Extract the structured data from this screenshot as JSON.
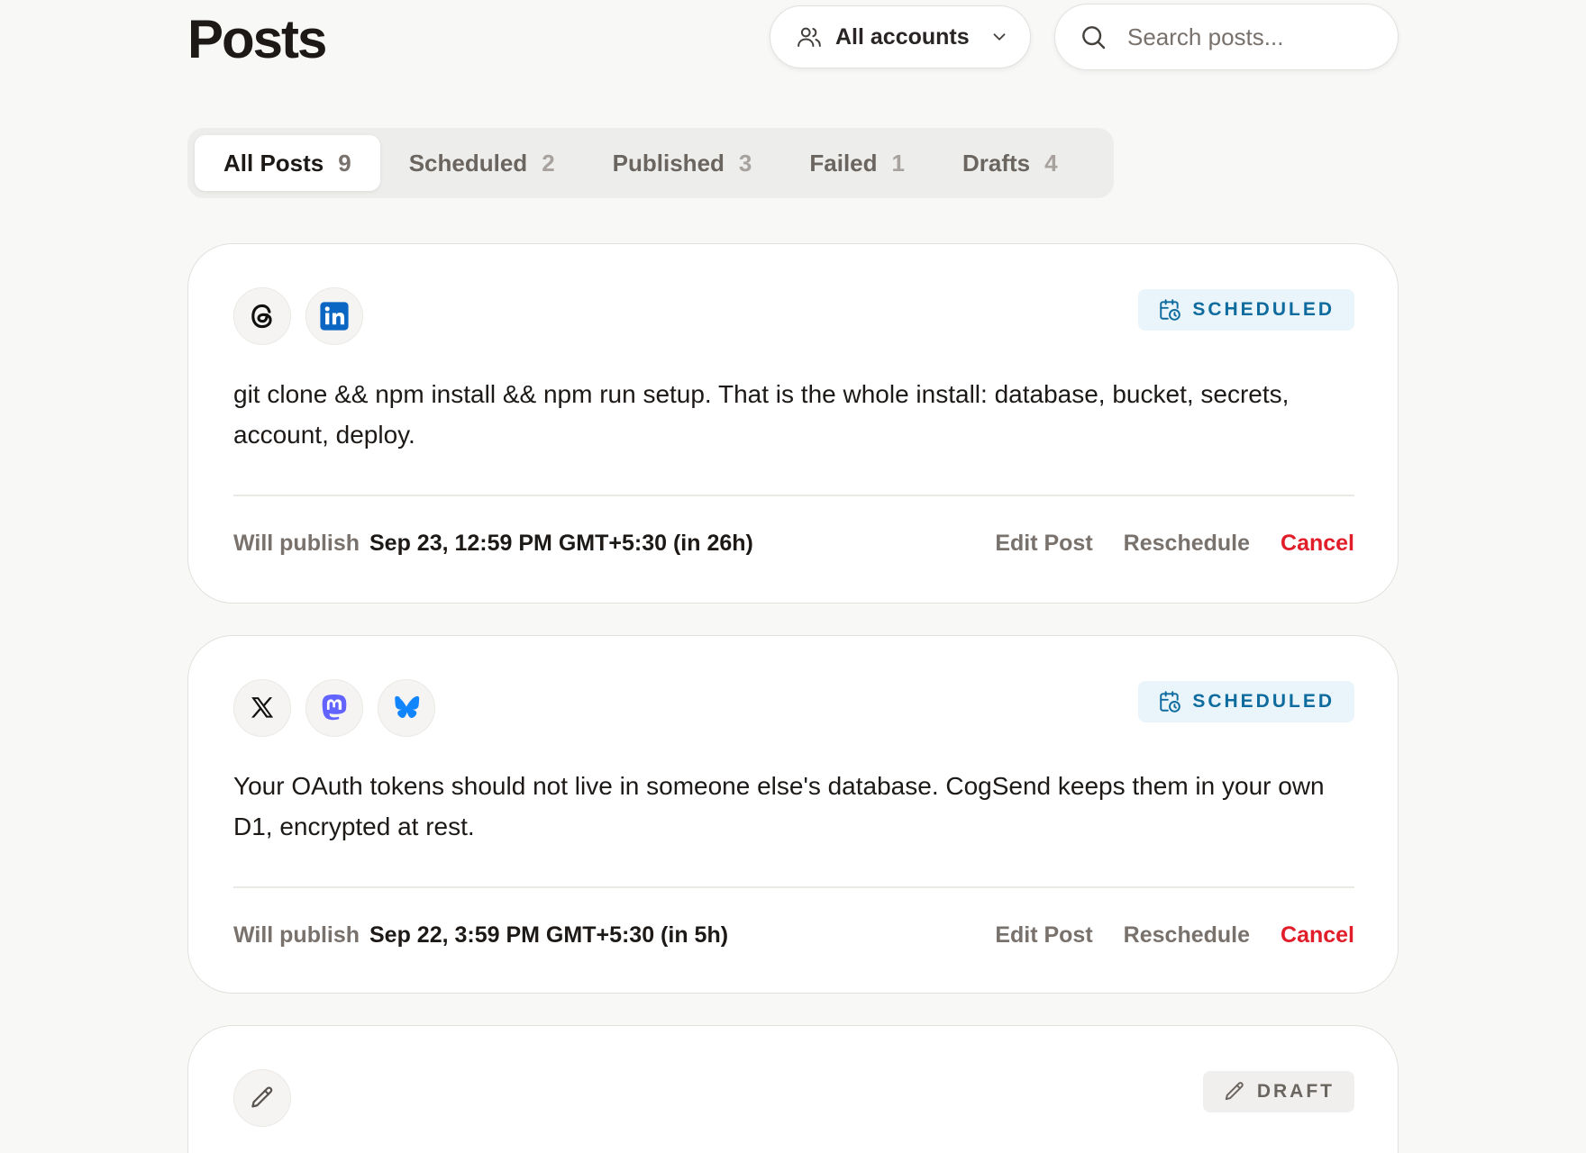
{
  "header": {
    "title": "Posts",
    "accounts_label": "All accounts",
    "search_placeholder": "Search posts..."
  },
  "tabs": [
    {
      "label": "All Posts",
      "count": "9",
      "active": true
    },
    {
      "label": "Scheduled",
      "count": "2"
    },
    {
      "label": "Published",
      "count": "3"
    },
    {
      "label": "Failed",
      "count": "1"
    },
    {
      "label": "Drafts",
      "count": "4"
    }
  ],
  "posts": [
    {
      "platforms": [
        "threads-icon",
        "linkedin-icon"
      ],
      "status": "SCHEDULED",
      "text": "git clone && npm install && npm run setup. That is the whole install: database, bucket, secrets, account, deploy.",
      "publish_label": "Will publish",
      "publish_time": "Sep 23, 12:59 PM GMT+5:30 (in 26h)",
      "actions": {
        "edit": "Edit Post",
        "reschedule": "Reschedule",
        "cancel": "Cancel"
      }
    },
    {
      "platforms": [
        "x-icon",
        "mastodon-icon",
        "bluesky-icon"
      ],
      "status": "SCHEDULED",
      "text": "Your OAuth tokens should not live in someone else's database. CogSend keeps them in your own D1, encrypted at rest.",
      "publish_label": "Will publish",
      "publish_time": "Sep 22, 3:59 PM GMT+5:30 (in 5h)",
      "actions": {
        "edit": "Edit Post",
        "reschedule": "Reschedule",
        "cancel": "Cancel"
      }
    },
    {
      "platforms": [
        "pencil-icon"
      ],
      "status": "DRAFT"
    }
  ],
  "colors": {
    "accent_scheduled": "#0e6b9e",
    "danger": "#e11d2a",
    "linkedin": "#0a66c2",
    "mastodon": "#6364ff",
    "bluesky": "#1185fe"
  }
}
